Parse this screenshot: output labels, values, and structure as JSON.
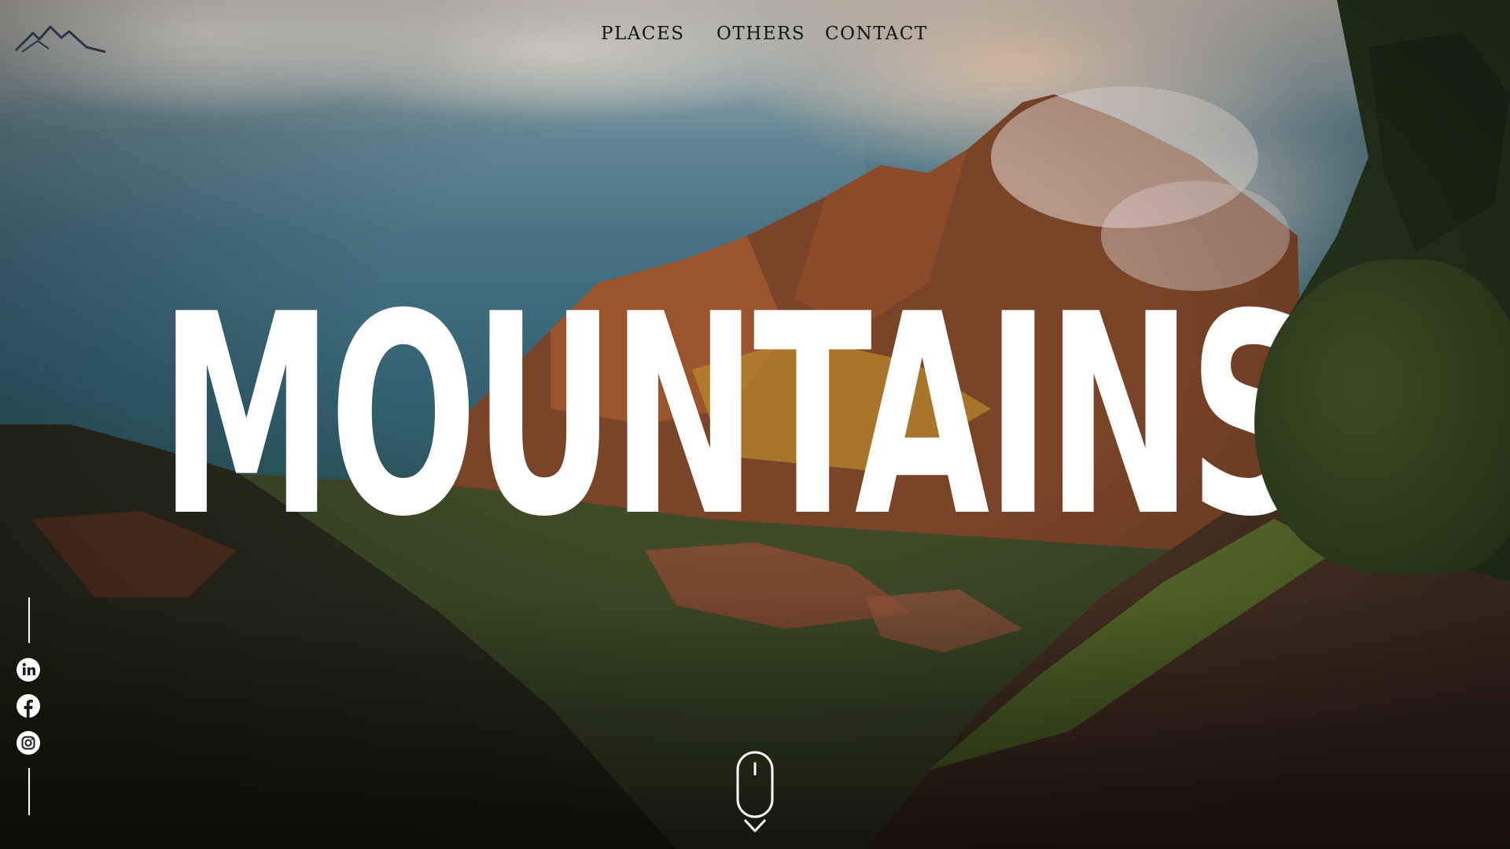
{
  "nav": {
    "items": [
      {
        "label": "PLACES"
      },
      {
        "label": "OTHERS"
      },
      {
        "label": "CONTACT"
      }
    ]
  },
  "logo": {
    "icon": "mountain-logo-icon"
  },
  "hero": {
    "title": "MOUNTAINS"
  },
  "social": {
    "items": [
      {
        "icon": "linkedin-icon"
      },
      {
        "icon": "facebook-icon"
      },
      {
        "icon": "instagram-icon"
      }
    ]
  },
  "scroll": {
    "icon": "mouse-scroll-icon"
  },
  "colors": {
    "title": "#ffffff",
    "nav_text": "#141414",
    "accent_sky": "#e6c8af",
    "sea": "#31606f",
    "foliage": "#2c3a1c"
  }
}
